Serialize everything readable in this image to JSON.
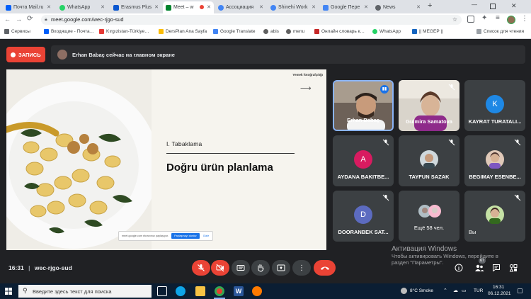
{
  "tabs": [
    {
      "label": "Почта Mail.ru",
      "color": "#005ff9"
    },
    {
      "label": "WhatsApp",
      "color": "#25d366"
    },
    {
      "label": "Erasmus Plus",
      "color": "#0b57d0"
    },
    {
      "label": "Meet – w",
      "color": "#00832d"
    },
    {
      "label": "Ассоциация",
      "color": "#4285f4"
    },
    {
      "label": "Shinehi Work",
      "color": "#4285f4"
    },
    {
      "label": "Google Пере",
      "color": "#4285f4"
    },
    {
      "label": "News",
      "color": "#5f6368"
    }
  ],
  "address_bar": {
    "url": "meet.google.com/wec-rjgo-sud"
  },
  "bookmarks": [
    {
      "label": "Сервисы"
    },
    {
      "label": "Входящие - Почта…"
    },
    {
      "label": "Kırgızistan-Türkiye…"
    },
    {
      "label": "DersPlan Ana Sayfa"
    },
    {
      "label": "Google Translate"
    },
    {
      "label": "abis"
    },
    {
      "label": "menu"
    },
    {
      "label": "Онлайн словарь к…"
    },
    {
      "label": "WhatsApp"
    },
    {
      "label": "|| MEGEP ||"
    }
  ],
  "reading_list": "Список для чтения",
  "meet": {
    "record_label": "ЗАПИСЬ",
    "presenting_text": "Erhan Babaç сейчас на главном экране",
    "slide": {
      "brand": "Yemek fotoğrafçılığı",
      "section": "I. Tabaklama",
      "title": "Doğru ürün planlama",
      "chip_text": "meet.google.com ekranınızı paylaşıyor.",
      "chip_button": "Paylaşmayı durdur",
      "chip_hide": "Gizle"
    },
    "participants": [
      {
        "name": "Erhan Babaç",
        "type": "video",
        "active": true
      },
      {
        "name": "Gulmira Samatova",
        "type": "video"
      },
      {
        "name": "KAYRAT TURATALI...",
        "type": "avatar",
        "initial": "K",
        "color": "#1e88e5"
      },
      {
        "name": "AYDANA BAKITBE...",
        "type": "avatar",
        "initial": "A",
        "color": "#d81b60"
      },
      {
        "name": "TAYFUN SAZAK",
        "type": "photo"
      },
      {
        "name": "BEGIMAY ESENBE...",
        "type": "photo"
      },
      {
        "name": "DOORANBEK SAT...",
        "type": "avatar",
        "initial": "D",
        "color": "#5c6bc0"
      },
      {
        "name": "Ещё 58 чел.",
        "type": "group"
      },
      {
        "name": "Вы",
        "type": "photo"
      }
    ],
    "bottom": {
      "time": "16:31",
      "meeting_code": "wec-rjgo-sud",
      "participant_count": "67"
    },
    "watermark": {
      "title": "Активация Windows",
      "line1": "Чтобы активировать Windows, перейдите в",
      "line2": "раздел \"Параметры\"."
    }
  },
  "taskbar": {
    "search_placeholder": "Введите здесь текст для поиска",
    "weather": "8°C Smoke",
    "lang": "TUR",
    "time": "16:31",
    "date": "06.12.2021"
  }
}
